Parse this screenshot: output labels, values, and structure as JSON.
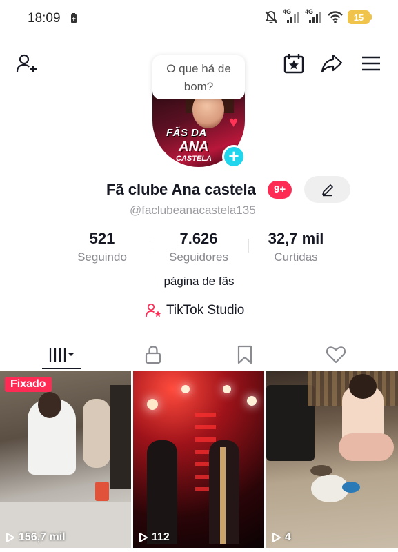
{
  "status": {
    "time": "18:09",
    "net1": "4G",
    "net2": "4G",
    "battery": "15",
    "battery_color": "#f0c34a"
  },
  "top_nav": {
    "icons": [
      "add-friend-icon",
      "calendar-star-icon",
      "share-icon",
      "menu-icon"
    ]
  },
  "bubble": {
    "text": "O que há de bom?"
  },
  "profile": {
    "name": "Fã clube Ana castela",
    "notification_count": "9+",
    "handle": "@faclubeanacastela135",
    "bio": "página de fãs",
    "avatar_text": {
      "line1": "FÃS DA",
      "line2": "ANA",
      "line3": "CASTELA"
    }
  },
  "stats": [
    {
      "value": "521",
      "label": "Seguindo"
    },
    {
      "value": "7.626",
      "label": "Seguidores"
    },
    {
      "value": "32,7 mil",
      "label": "Curtidas"
    }
  ],
  "studio": {
    "label": "TikTok Studio"
  },
  "tabs": [
    {
      "icon": "grid-icon",
      "active": true
    },
    {
      "icon": "lock-icon",
      "active": false
    },
    {
      "icon": "bookmark-icon",
      "active": false
    },
    {
      "icon": "heart-icon",
      "active": false
    }
  ],
  "videos": [
    {
      "badge": "Fixado",
      "views": "156,7 mil"
    },
    {
      "badge": "",
      "views": "112"
    },
    {
      "badge": "",
      "views": "4"
    }
  ],
  "colors": {
    "accent": "#fe2c55",
    "plus": "#20d5ec",
    "text": "#161823",
    "secondary": "#8a8b91"
  }
}
